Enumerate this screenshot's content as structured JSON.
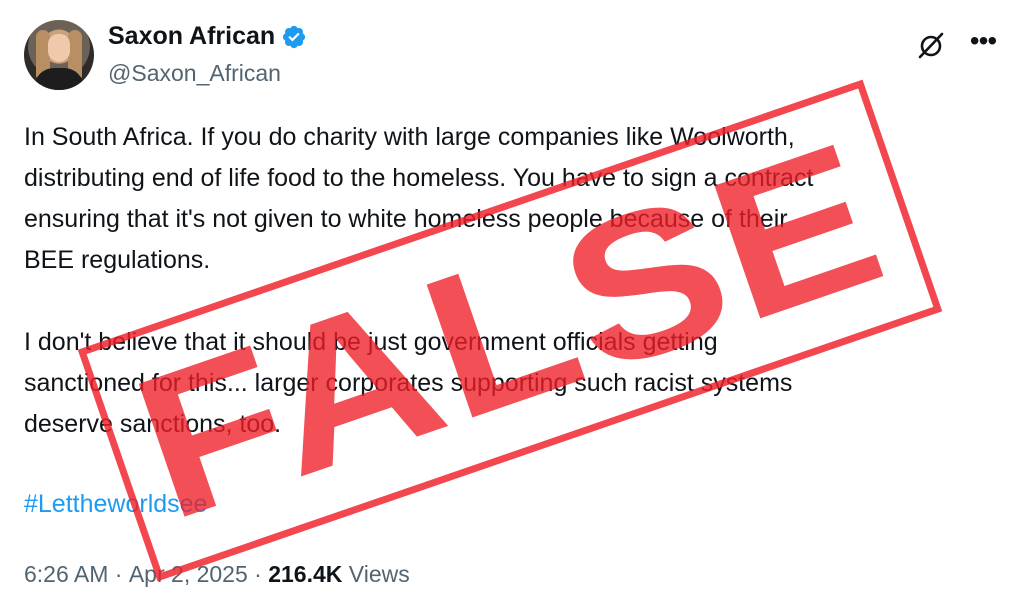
{
  "author": {
    "display_name": "Saxon African",
    "handle": "@Saxon_African",
    "verified": true
  },
  "tweet": {
    "paragraph_1": "In South Africa. If you do charity with large companies like Woolworth,\ndistributing end of life food to the homeless. You have to sign a contract\nensuring that it's not given to white homeless people  because of their\nBEE regulations.",
    "paragraph_2": "I don't believe  that it should be just government officials getting\nsanctioned for this... larger corporates supporting such racist systems\ndeserve sanctions, too.",
    "hashtag": "#Lettheworldsee"
  },
  "meta": {
    "time": "6:26 AM",
    "separator": " · ",
    "date": "Apr 2, 2025",
    "views_count": "216.4K",
    "views_label": " Views"
  },
  "overlay": {
    "stamp_text": "FALSE",
    "stamp_color": "#f01e28"
  },
  "colors": {
    "text": "#0f1419",
    "secondary": "#536471",
    "link": "#1d9bf0",
    "verified": "#1d9bf0"
  },
  "icons": {
    "verified": "verified-badge-icon",
    "grok": "grok-icon",
    "more": "more-icon"
  }
}
